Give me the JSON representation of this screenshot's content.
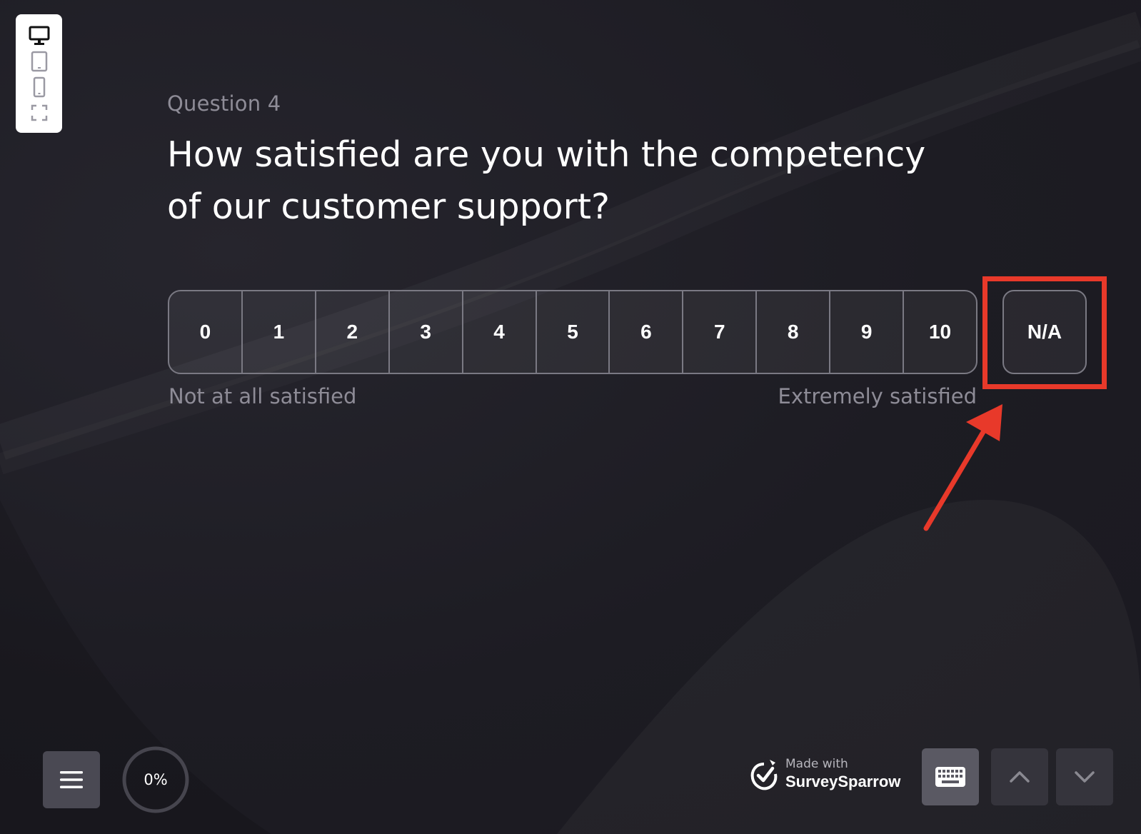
{
  "device_toolbar": {
    "items": [
      {
        "icon": "desktop-icon"
      },
      {
        "icon": "tablet-icon"
      },
      {
        "icon": "mobile-icon"
      },
      {
        "icon": "fullscreen-icon"
      }
    ]
  },
  "question": {
    "number_label": "Question 4",
    "title": "How satisfied are you with the competency of our customer support?"
  },
  "scale": {
    "options": [
      "0",
      "1",
      "2",
      "3",
      "4",
      "5",
      "6",
      "7",
      "8",
      "9",
      "10"
    ],
    "na_label": "N/A",
    "min_label": "Not at all satisfied",
    "max_label": "Extremely satisfied"
  },
  "annotation": {
    "color": "#e8392a",
    "target": "N/A"
  },
  "footer": {
    "menu_icon": "hamburger-menu-icon",
    "progress_text": "0%",
    "progress_value": 0,
    "brand_made_with": "Made with",
    "brand_name": "SurveySparrow",
    "keyboard_icon": "keyboard-icon",
    "prev_icon": "chevron-up-icon",
    "next_icon": "chevron-down-icon"
  }
}
